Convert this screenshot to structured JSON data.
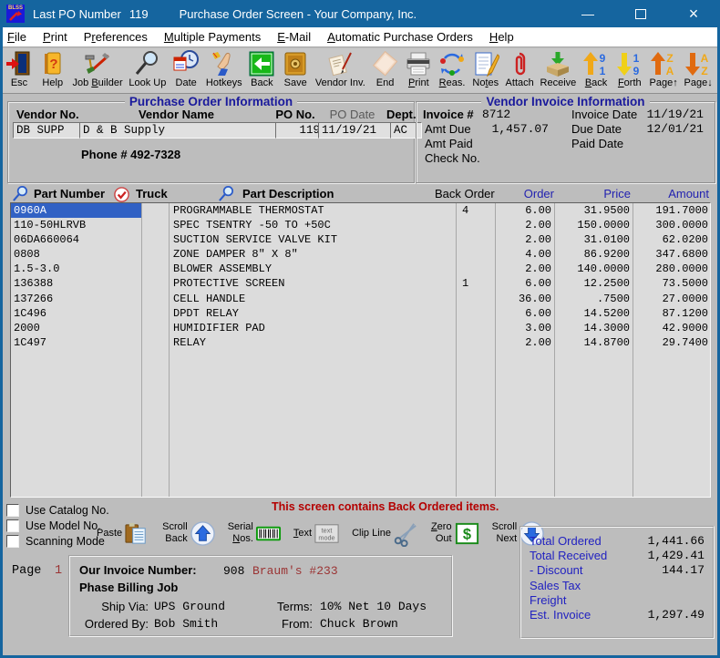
{
  "window": {
    "badge": "BLSS",
    "left_label": "Last PO Number",
    "po_number": "119",
    "title": "Purchase Order Screen - Your Company, Inc.",
    "controls": {
      "minimize": "—",
      "close": "×"
    }
  },
  "menu": [
    {
      "label": "File",
      "u": 0
    },
    {
      "label": "Print",
      "u": 0
    },
    {
      "label": "Preferences",
      "u": 1
    },
    {
      "label": "Multiple Payments",
      "u": 0
    },
    {
      "label": "E-Mail",
      "u": 0
    },
    {
      "label": "Automatic Purchase Orders",
      "u": 0
    },
    {
      "label": "Help",
      "u": 0
    }
  ],
  "toolbar": [
    {
      "label": "Esc",
      "icon": "esc"
    },
    {
      "label": "Help",
      "icon": "help"
    },
    {
      "label": "Job Builder",
      "u": 4,
      "icon": "job-builder"
    },
    {
      "label": "Look Up",
      "icon": "look-up"
    },
    {
      "label": "Date",
      "icon": "date"
    },
    {
      "label": "Hotkeys",
      "icon": "hotkeys"
    },
    {
      "label": "Back",
      "icon": "back-arrow"
    },
    {
      "label": "Save",
      "icon": "save"
    },
    {
      "label": "Vendor Inv.",
      "icon": "vendor-inv"
    },
    {
      "label": "End",
      "icon": "end"
    },
    {
      "label": "Print",
      "u": 0,
      "icon": "print"
    },
    {
      "label": "Reas.",
      "u": 0,
      "icon": "reassign"
    },
    {
      "label": "Notes",
      "u": 2,
      "icon": "notes"
    },
    {
      "label": "Attach",
      "icon": "attach"
    },
    {
      "label": "Receive",
      "icon": "receive"
    },
    {
      "label": "Back",
      "u": 0,
      "icon": "back-91"
    },
    {
      "label": "Forth",
      "u": 0,
      "icon": "forth-19"
    },
    {
      "label": "Page↑",
      "icon": "page-up"
    },
    {
      "label": "Page↓",
      "icon": "page-down"
    }
  ],
  "po_info": {
    "legend": "Purchase Order Information",
    "headers": {
      "vendor_no": "Vendor No.",
      "vendor_name": "Vendor Name",
      "po_no": "PO No.",
      "po_date": "PO Date",
      "dept": "Dept."
    },
    "vendor_no": "DB SUPP",
    "vendor_name": "D & B Supply",
    "po_no": "119",
    "po_date": "11/19/21",
    "dept": "AC",
    "phone": "Phone # 492-7328"
  },
  "invoice_info": {
    "legend": "Vendor Invoice Information",
    "invoice_no_label": "Invoice #",
    "invoice_no": "8712",
    "amt_due_label": "Amt Due",
    "amt_due": "1,457.07",
    "amt_paid_label": "Amt Paid",
    "amt_paid": "",
    "check_no_label": "Check No.",
    "check_no": "",
    "invoice_date_label": "Invoice Date",
    "invoice_date": "11/19/21",
    "due_date_label": "Due Date",
    "due_date": "12/01/21",
    "paid_date_label": "Paid Date",
    "paid_date": ""
  },
  "table": {
    "headers": {
      "part_number": "Part Number",
      "truck": "Truck",
      "part_description": "Part Description",
      "back_order": "Back Order",
      "order": "Order",
      "price": "Price",
      "amount": "Amount"
    },
    "rows": [
      {
        "part": "0960A",
        "truck": "",
        "desc": "PROGRAMMABLE THERMOSTAT",
        "back_order": "4",
        "order": "6.00",
        "price": "31.9500",
        "amount": "191.7000",
        "selected": true
      },
      {
        "part": "110-50HLRVB",
        "truck": "",
        "desc": "SPEC TSENTRY -50 TO +50C",
        "back_order": "",
        "order": "2.00",
        "price": "150.0000",
        "amount": "300.0000",
        "selected": false
      },
      {
        "part": "06DA660064",
        "truck": "",
        "desc": "SUCTION SERVICE VALVE KIT",
        "back_order": "",
        "order": "2.00",
        "price": "31.0100",
        "amount": "62.0200",
        "selected": false
      },
      {
        "part": "0808",
        "truck": "",
        "desc": "ZONE DAMPER 8\" X 8\"",
        "back_order": "",
        "order": "4.00",
        "price": "86.9200",
        "amount": "347.6800",
        "selected": false
      },
      {
        "part": "1.5-3.0",
        "truck": "",
        "desc": "BLOWER ASSEMBLY",
        "back_order": "",
        "order": "2.00",
        "price": "140.0000",
        "amount": "280.0000",
        "selected": false
      },
      {
        "part": "136388",
        "truck": "",
        "desc": "PROTECTIVE SCREEN",
        "back_order": "1",
        "order": "6.00",
        "price": "12.2500",
        "amount": "73.5000",
        "selected": false
      },
      {
        "part": "137266",
        "truck": "",
        "desc": "CELL HANDLE",
        "back_order": "",
        "order": "36.00",
        "price": ".7500",
        "amount": "27.0000",
        "selected": false
      },
      {
        "part": "1C496",
        "truck": "",
        "desc": "DPDT RELAY",
        "back_order": "",
        "order": "6.00",
        "price": "14.5200",
        "amount": "87.1200",
        "selected": false
      },
      {
        "part": "2000",
        "truck": "",
        "desc": "HUMIDIFIER PAD",
        "back_order": "",
        "order": "3.00",
        "price": "14.3000",
        "amount": "42.9000",
        "selected": false
      },
      {
        "part": "1C497",
        "truck": "",
        "desc": "RELAY",
        "back_order": "",
        "order": "2.00",
        "price": "14.8700",
        "amount": "29.7400",
        "selected": false
      }
    ]
  },
  "options": [
    {
      "label": "Use Catalog No.",
      "checked": false
    },
    {
      "label": "Use Model No.",
      "checked": false
    },
    {
      "label": "Scanning Mode",
      "checked": false
    }
  ],
  "warning": "This screen contains Back Ordered items.",
  "actions": [
    {
      "label": "Paste",
      "icon": "paste"
    },
    {
      "label": "Scroll\nBack",
      "icon": "scroll-up"
    },
    {
      "label": "Serial\nNos.",
      "u": 7,
      "icon": "serial"
    },
    {
      "label": "Text",
      "u": 0,
      "icon": "text-mode"
    },
    {
      "label": "Clip Line",
      "icon": "clip-line"
    },
    {
      "label": "Zero\nOut",
      "u": 0,
      "icon": "zero-out"
    },
    {
      "label": "Scroll\nNext",
      "icon": "scroll-down"
    }
  ],
  "footer": {
    "page_label": "Page",
    "page_number": "1",
    "our_invoice_label": "Our Invoice Number:",
    "our_invoice_number": "908",
    "our_invoice_note": "Braum's #233",
    "phase_billing_label": "Phase Billing Job",
    "ship_via_label": "Ship Via:",
    "ship_via": "UPS Ground",
    "terms_label": "Terms:",
    "terms": "10% Net 10 Days",
    "ordered_by_label": "Ordered By:",
    "ordered_by": "Bob Smith",
    "from_label": "From:",
    "from": "Chuck Brown"
  },
  "totals": [
    {
      "label": "Total Ordered",
      "value": "1,441.66"
    },
    {
      "label": "Total Received",
      "value": "1,429.41"
    },
    {
      "label": "- Discount",
      "value": "144.17"
    },
    {
      "label": "Sales Tax",
      "value": ""
    },
    {
      "label": "Freight",
      "value": ""
    },
    {
      "label": "Est. Invoice",
      "value": "1,297.49"
    }
  ]
}
